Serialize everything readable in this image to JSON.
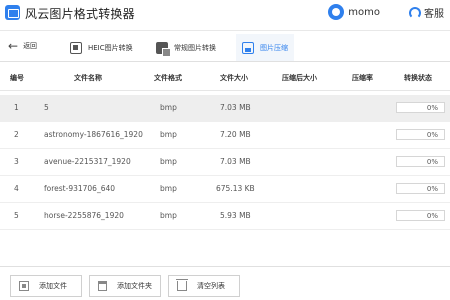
{
  "app": {
    "title": "风云图片格式转换器",
    "user_name": "momo",
    "support_label": "客服"
  },
  "nav": {
    "back_label": "返回",
    "tabs": [
      {
        "label": "HEIC图片转换",
        "icon": "heic-icon",
        "active": false
      },
      {
        "label": "常规图片转换",
        "icon": "image-convert-icon",
        "active": false
      },
      {
        "label": "图片压缩",
        "icon": "compress-icon",
        "active": true
      }
    ]
  },
  "table": {
    "columns": [
      "编号",
      "文件名称",
      "文件格式",
      "文件大小",
      "压缩后大小",
      "压缩率",
      "转换状态"
    ],
    "rows": [
      {
        "index": "1",
        "name": "5",
        "format": "bmp",
        "size": "7.03 MB",
        "compressed_size": "",
        "ratio": "",
        "progress": "0%",
        "selected": true
      },
      {
        "index": "2",
        "name": "astronomy-1867616_1920",
        "format": "bmp",
        "size": "7.20 MB",
        "compressed_size": "",
        "ratio": "",
        "progress": "0%",
        "selected": false
      },
      {
        "index": "3",
        "name": "avenue-2215317_1920",
        "format": "bmp",
        "size": "7.03 MB",
        "compressed_size": "",
        "ratio": "",
        "progress": "0%",
        "selected": false
      },
      {
        "index": "4",
        "name": "forest-931706_640",
        "format": "bmp",
        "size": "675.13 KB",
        "compressed_size": "",
        "ratio": "",
        "progress": "0%",
        "selected": false
      },
      {
        "index": "5",
        "name": "horse-2255876_1920",
        "format": "bmp",
        "size": "5.93 MB",
        "compressed_size": "",
        "ratio": "",
        "progress": "0%",
        "selected": false
      }
    ]
  },
  "actions": {
    "add_file": "添加文件",
    "add_folder": "添加文件夹",
    "clear_list": "清空列表"
  },
  "colors": {
    "accent": "#2f80ed",
    "selected_row": "#eeeeee"
  }
}
